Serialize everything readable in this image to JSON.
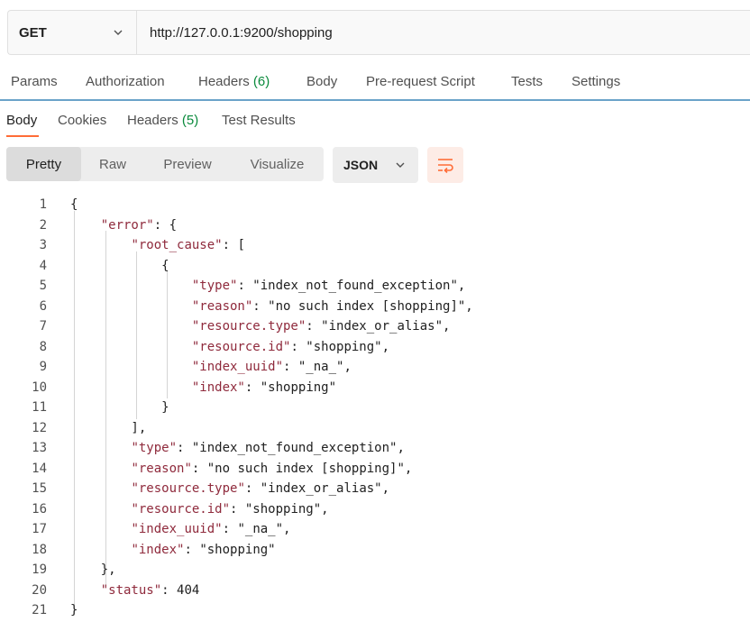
{
  "request": {
    "method": "GET",
    "url": "http://127.0.0.1:9200/shopping"
  },
  "request_tabs": [
    {
      "label": "Params"
    },
    {
      "label": "Authorization"
    },
    {
      "label": "Headers",
      "count": "(6)"
    },
    {
      "label": "Body"
    },
    {
      "label": "Pre-request Script"
    },
    {
      "label": "Tests"
    },
    {
      "label": "Settings"
    }
  ],
  "response_tabs": [
    {
      "label": "Body",
      "active": true
    },
    {
      "label": "Cookies"
    },
    {
      "label": "Headers",
      "count": "(5)"
    },
    {
      "label": "Test Results"
    }
  ],
  "view_modes": [
    {
      "label": "Pretty",
      "active": true
    },
    {
      "label": "Raw"
    },
    {
      "label": "Preview"
    },
    {
      "label": "Visualize"
    }
  ],
  "format": "JSON",
  "icons": {
    "method_dropdown": "chevron-down-icon",
    "format_dropdown": "chevron-down-icon",
    "wrap": "wrap-lines-icon"
  },
  "colors": {
    "accent": "#ff6c37",
    "count": "#0a8a3c",
    "key": "#8f2a3c",
    "string": "#0e4d88",
    "tab_border": "#6aa3c9"
  },
  "code_lines": [
    {
      "n": "1",
      "text": "{"
    },
    {
      "n": "2",
      "text": "    \"error\": {"
    },
    {
      "n": "3",
      "text": "        \"root_cause\": ["
    },
    {
      "n": "4",
      "text": "            {"
    },
    {
      "n": "5",
      "text": "                \"type\": \"index_not_found_exception\","
    },
    {
      "n": "6",
      "text": "                \"reason\": \"no such index [shopping]\","
    },
    {
      "n": "7",
      "text": "                \"resource.type\": \"index_or_alias\","
    },
    {
      "n": "8",
      "text": "                \"resource.id\": \"shopping\","
    },
    {
      "n": "9",
      "text": "                \"index_uuid\": \"_na_\","
    },
    {
      "n": "10",
      "text": "                \"index\": \"shopping\""
    },
    {
      "n": "11",
      "text": "            }"
    },
    {
      "n": "12",
      "text": "        ],"
    },
    {
      "n": "13",
      "text": "        \"type\": \"index_not_found_exception\","
    },
    {
      "n": "14",
      "text": "        \"reason\": \"no such index [shopping]\","
    },
    {
      "n": "15",
      "text": "        \"resource.type\": \"index_or_alias\","
    },
    {
      "n": "16",
      "text": "        \"resource.id\": \"shopping\","
    },
    {
      "n": "17",
      "text": "        \"index_uuid\": \"_na_\","
    },
    {
      "n": "18",
      "text": "        \"index\": \"shopping\""
    },
    {
      "n": "19",
      "text": "    },"
    },
    {
      "n": "20",
      "text": "    \"status\": 404"
    },
    {
      "n": "21",
      "text": "}"
    }
  ]
}
